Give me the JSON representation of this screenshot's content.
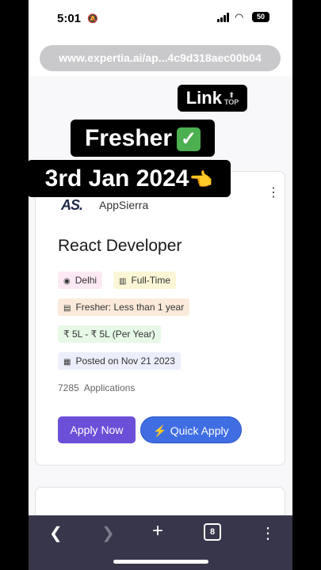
{
  "status_bar": {
    "time": "5:01",
    "battery": "50"
  },
  "browser": {
    "url": "www.expertia.ai/ap...4c9d318aec00b04",
    "tab_count": "8"
  },
  "overlay": {
    "link_label": "Link",
    "top_label": "TOP",
    "fresher_label": "Fresher",
    "date_label": "3rd Jan 2024"
  },
  "job": {
    "company_logo": "AS.",
    "company": "AppSierra",
    "title": "React Developer",
    "location": "Delhi",
    "job_type": "Full-Time",
    "experience": "Fresher: Less than 1 year",
    "salary": "₹ 5L - ₹ 5L (Per Year)",
    "posted": "Posted on Nov 21 2023",
    "applications_count": "7285",
    "applications_label": "Applications",
    "apply_label": "Apply Now",
    "quick_apply_label": "Quick Apply"
  },
  "colors": {
    "apply_button": "#6c4fd8",
    "quick_apply_button": "#3f6ee3",
    "nav_bar": "#37364a"
  },
  "icons": [
    "bell-slash-icon",
    "signal-icon",
    "wifi-icon",
    "battery-icon",
    "location-pin-icon",
    "building-icon",
    "briefcase-icon",
    "calendar-icon",
    "lightning-icon",
    "back-icon",
    "forward-icon",
    "plus-icon",
    "more-icon",
    "check-icon",
    "pointing-hand-icon"
  ]
}
